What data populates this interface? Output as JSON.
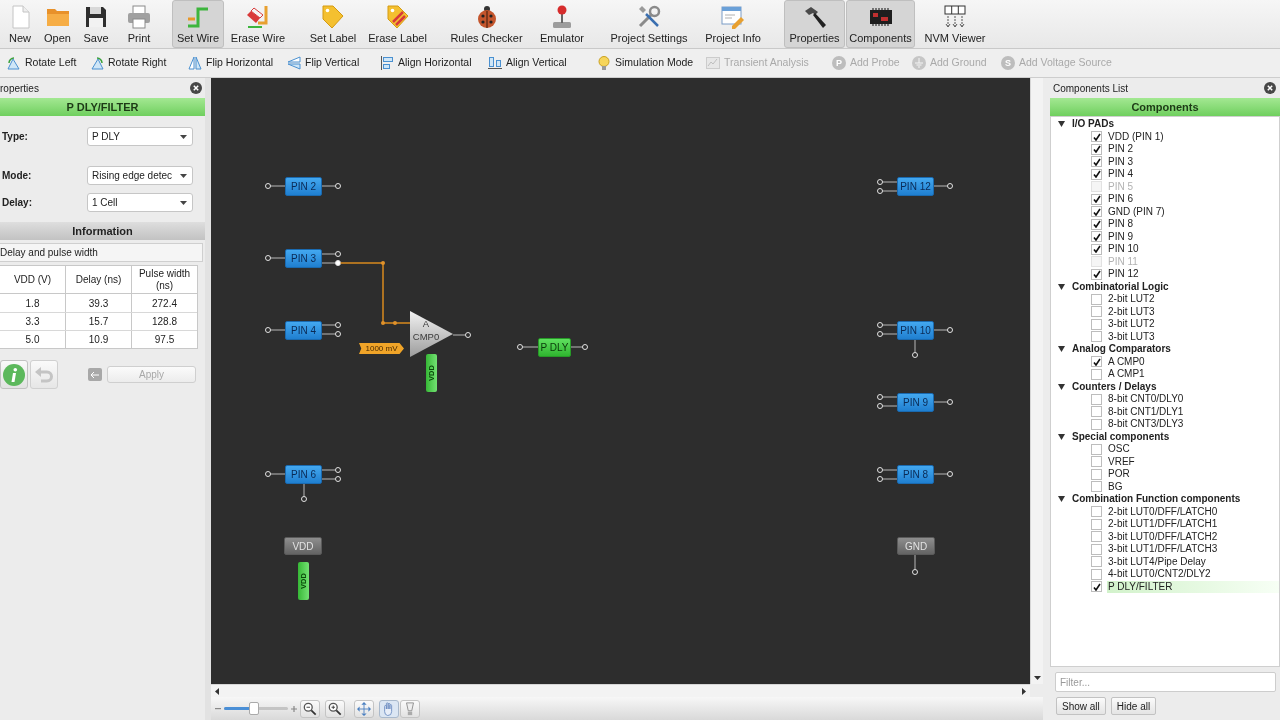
{
  "toolbar": {
    "buttons": [
      {
        "label": "New",
        "selected": false
      },
      {
        "label": "Open",
        "selected": false
      },
      {
        "label": "Save",
        "selected": false
      },
      {
        "label": "Print",
        "selected": false
      },
      {
        "label": "Set Wire",
        "selected": true
      },
      {
        "label": "Erase Wire",
        "selected": false
      },
      {
        "label": "Set Label",
        "selected": false
      },
      {
        "label": "Erase Label",
        "selected": false
      },
      {
        "label": "Rules Checker",
        "selected": false
      },
      {
        "label": "Emulator",
        "selected": false
      },
      {
        "label": "Project Settings",
        "selected": false
      },
      {
        "label": "Project Info",
        "selected": false
      },
      {
        "label": "Properties",
        "selected": true
      },
      {
        "label": "Components",
        "selected": true
      },
      {
        "label": "NVM Viewer",
        "selected": false
      }
    ]
  },
  "actions": [
    {
      "label": "Rotate Left",
      "disabled": false
    },
    {
      "label": "Rotate Right",
      "disabled": false
    },
    {
      "label": "Flip Horizontal",
      "disabled": false
    },
    {
      "label": "Flip Vertical",
      "disabled": false
    },
    {
      "label": "Align Horizontal",
      "disabled": false
    },
    {
      "label": "Align Vertical",
      "disabled": false
    },
    {
      "label": "Simulation Mode",
      "disabled": false
    },
    {
      "label": "Transient Analysis",
      "disabled": true
    },
    {
      "label": "Add Probe",
      "symbol": "P",
      "disabled": true
    },
    {
      "label": "Add Ground",
      "disabled": true
    },
    {
      "label": "Add Voltage Source",
      "symbol": "S",
      "disabled": true
    }
  ],
  "properties": {
    "title": "roperties",
    "heading": "P DLY/FILTER",
    "fields": [
      {
        "label": "Type:",
        "value": "P DLY"
      },
      {
        "label": "Mode:",
        "value": "Rising edge detec"
      },
      {
        "label": "Delay:",
        "value": "1 Cell"
      }
    ],
    "section": "Information",
    "caption": "Delay and pulse width",
    "table": {
      "columns": [
        "VDD (V)",
        "Delay (ns)",
        "Pulse width (ns)"
      ],
      "rows": [
        [
          "1.8",
          "39.3",
          "272.4"
        ],
        [
          "3.3",
          "15.7",
          "128.8"
        ],
        [
          "5.0",
          "10.9",
          "97.5"
        ]
      ]
    },
    "undo": {
      "disabled": true
    },
    "apply": {
      "label": "Apply",
      "disabled": true
    }
  },
  "canvas": {
    "nodes": [
      {
        "kind": "pin",
        "label": "PIN 2"
      },
      {
        "kind": "pin",
        "label": "PIN 3"
      },
      {
        "kind": "pin",
        "label": "PIN 4"
      },
      {
        "kind": "pin",
        "label": "PIN 6"
      },
      {
        "kind": "supply",
        "label": "VDD"
      },
      {
        "kind": "comparator",
        "label": "A CMP0"
      },
      {
        "kind": "delay",
        "label": "P DLY"
      },
      {
        "kind": "pin",
        "label": "PIN 12"
      },
      {
        "kind": "pin",
        "label": "PIN 10"
      },
      {
        "kind": "pin",
        "label": "PIN 9"
      },
      {
        "kind": "pin",
        "label": "PIN 8"
      },
      {
        "kind": "supply",
        "label": "GND"
      }
    ],
    "tags": [
      {
        "kind": "voltage",
        "label": "1000 mV"
      },
      {
        "kind": "supply",
        "label": "VDD"
      },
      {
        "kind": "supply",
        "label": "VDD"
      }
    ]
  },
  "zoom_bar": {
    "level": 0.47,
    "tools": [
      {
        "selected": false
      },
      {
        "selected": false
      },
      {
        "selected": false
      },
      {
        "selected": true
      },
      {
        "selected": false
      }
    ]
  },
  "components_list": {
    "title": "Components List",
    "heading": "Components",
    "groups": [
      {
        "label": "I/O PADs",
        "expanded": true,
        "children": [
          {
            "label": "VDD (PIN 1)",
            "checked": true,
            "disabled": false,
            "selected": false
          },
          {
            "label": "PIN 2",
            "checked": true,
            "disabled": false,
            "selected": false
          },
          {
            "label": "PIN 3",
            "checked": true,
            "disabled": false,
            "selected": false
          },
          {
            "label": "PIN 4",
            "checked": true,
            "disabled": false,
            "selected": false
          },
          {
            "label": "PIN 5",
            "checked": false,
            "disabled": true,
            "selected": false
          },
          {
            "label": "PIN 6",
            "checked": true,
            "disabled": false,
            "selected": false
          },
          {
            "label": "GND (PIN 7)",
            "checked": true,
            "disabled": false,
            "selected": false
          },
          {
            "label": "PIN 8",
            "checked": true,
            "disabled": false,
            "selected": false
          },
          {
            "label": "PIN 9",
            "checked": true,
            "disabled": false,
            "selected": false
          },
          {
            "label": "PIN 10",
            "checked": true,
            "disabled": false,
            "selected": false
          },
          {
            "label": "PIN 11",
            "checked": false,
            "disabled": true,
            "selected": false
          },
          {
            "label": "PIN 12",
            "checked": true,
            "disabled": false,
            "selected": false
          }
        ]
      },
      {
        "label": "Combinatorial Logic",
        "expanded": true,
        "children": [
          {
            "label": "2-bit LUT2",
            "checked": false,
            "disabled": false,
            "selected": false
          },
          {
            "label": "2-bit LUT3",
            "checked": false,
            "disabled": false,
            "selected": false
          },
          {
            "label": "3-bit LUT2",
            "checked": false,
            "disabled": false,
            "selected": false
          },
          {
            "label": "3-bit LUT3",
            "checked": false,
            "disabled": false,
            "selected": false
          }
        ]
      },
      {
        "label": "Analog Comparators",
        "expanded": true,
        "children": [
          {
            "label": "A CMP0",
            "checked": true,
            "disabled": false,
            "selected": false
          },
          {
            "label": "A CMP1",
            "checked": false,
            "disabled": false,
            "selected": false
          }
        ]
      },
      {
        "label": "Counters / Delays",
        "expanded": true,
        "children": [
          {
            "label": "8-bit CNT0/DLY0",
            "checked": false,
            "disabled": false,
            "selected": false
          },
          {
            "label": "8-bit CNT1/DLY1",
            "checked": false,
            "disabled": false,
            "selected": false
          },
          {
            "label": "8-bit CNT3/DLY3",
            "checked": false,
            "disabled": false,
            "selected": false
          }
        ]
      },
      {
        "label": "Special components",
        "expanded": true,
        "children": [
          {
            "label": "OSC",
            "checked": false,
            "disabled": false,
            "selected": false
          },
          {
            "label": "VREF",
            "checked": false,
            "disabled": false,
            "selected": false
          },
          {
            "label": "POR",
            "checked": false,
            "disabled": false,
            "selected": false
          },
          {
            "label": "BG",
            "checked": false,
            "disabled": false,
            "selected": false
          }
        ]
      },
      {
        "label": "Combination Function components",
        "expanded": true,
        "children": [
          {
            "label": "2-bit LUT0/DFF/LATCH0",
            "checked": false,
            "disabled": false,
            "selected": false
          },
          {
            "label": "2-bit LUT1/DFF/LATCH1",
            "checked": false,
            "disabled": false,
            "selected": false
          },
          {
            "label": "3-bit LUT0/DFF/LATCH2",
            "checked": false,
            "disabled": false,
            "selected": false
          },
          {
            "label": "3-bit LUT1/DFF/LATCH3",
            "checked": false,
            "disabled": false,
            "selected": false
          },
          {
            "label": "3-bit LUT4/Pipe Delay",
            "checked": false,
            "disabled": false,
            "selected": false
          },
          {
            "label": "4-bit LUT0/CNT2/DLY2",
            "checked": false,
            "disabled": false,
            "selected": false
          },
          {
            "label": "P DLY/FILTER",
            "checked": true,
            "disabled": false,
            "selected": true
          }
        ]
      }
    ],
    "filter": {
      "placeholder": "Filter..."
    },
    "buttons": [
      "Show all",
      "Hide all"
    ]
  }
}
